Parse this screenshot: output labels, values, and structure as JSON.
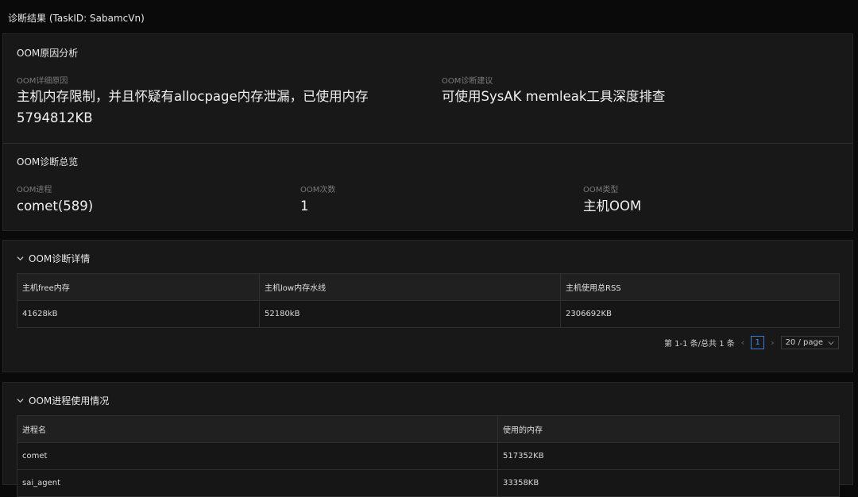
{
  "page": {
    "title": "诊断结果 (TaskID: SabamcVn)"
  },
  "cause": {
    "title": "OOM原因分析",
    "detail_label": "OOM详细原因",
    "detail_value_line1": "主机内存限制，并且怀疑有allocpage内存泄漏，已使用内存",
    "detail_value_line2": "5794812KB",
    "suggest_label": "OOM诊断建议",
    "suggest_value": "可使用SysAK memleak工具深度排查"
  },
  "overview": {
    "title": "OOM诊断总览",
    "process_label": "OOM进程",
    "process_value": "comet(589)",
    "count_label": "OOM次数",
    "count_value": "1",
    "type_label": "OOM类型",
    "type_value": "主机OOM"
  },
  "detail": {
    "title": "OOM诊断详情",
    "headers": [
      "主机free内存",
      "主机low内存水线",
      "主机使用总RSS"
    ],
    "rows": [
      [
        "41628kB",
        "52180kB",
        "2306692KB"
      ]
    ],
    "pager": {
      "summary": "第 1-1 条/总共 1 条",
      "page": "1",
      "size": "20 / page"
    }
  },
  "proc_usage": {
    "title": "OOM进程使用情况",
    "headers": [
      "进程名",
      "使用的内存"
    ],
    "rows": [
      [
        "comet",
        "517352KB"
      ],
      [
        "sai_agent",
        "33358KB"
      ]
    ]
  },
  "icons": {
    "collapse": "chevron-down-icon",
    "prev": "chevron-left-icon",
    "next": "chevron-right-icon"
  },
  "colors": {
    "accent": "#3a7bd5",
    "panel": "#181818",
    "background": "#0a0a0a"
  }
}
